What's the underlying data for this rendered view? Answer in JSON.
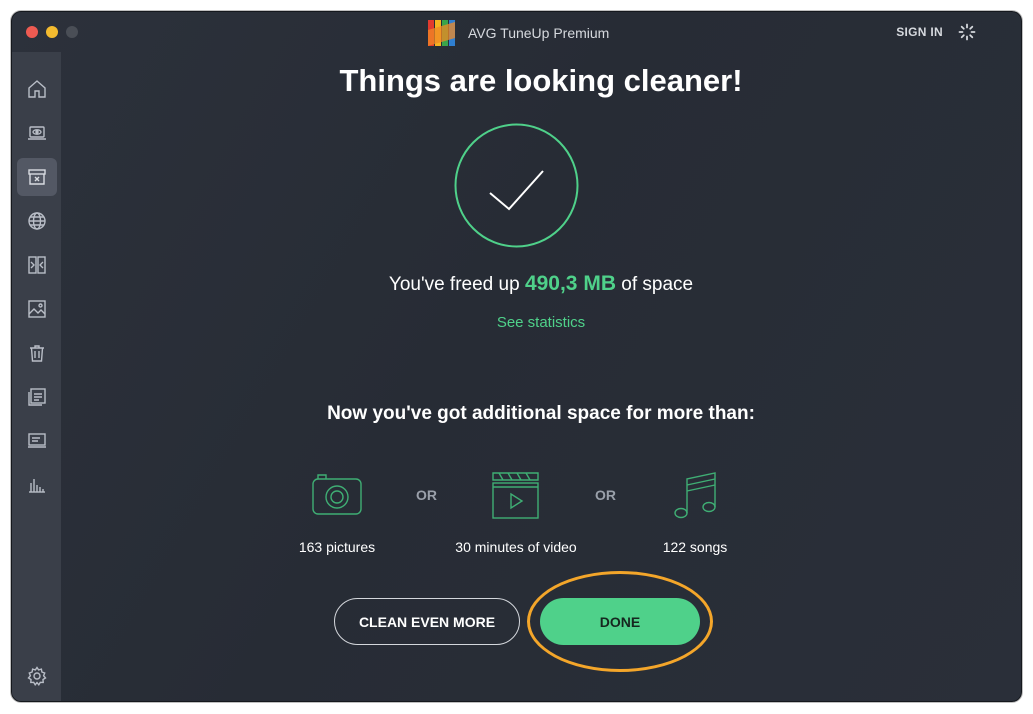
{
  "window": {
    "app_title": "AVG TuneUp Premium",
    "sign_in_label": "SIGN IN"
  },
  "sidebar": {
    "items": [
      {
        "icon": "home-icon",
        "active": false
      },
      {
        "icon": "laptop-eye-icon",
        "active": false
      },
      {
        "icon": "archive-icon",
        "active": true
      },
      {
        "icon": "globe-icon",
        "active": false
      },
      {
        "icon": "duplicate-files-icon",
        "active": false
      },
      {
        "icon": "photo-icon",
        "active": false
      },
      {
        "icon": "trash-icon",
        "active": false
      },
      {
        "icon": "apps-list-icon",
        "active": false
      },
      {
        "icon": "monitor-icon",
        "active": false
      },
      {
        "icon": "bar-chart-icon",
        "active": false
      }
    ],
    "settings_icon": "gear-icon"
  },
  "main": {
    "headline": "Things are looking cleaner!",
    "freed_prefix": "You've freed up",
    "freed_amount": "490,3 MB",
    "freed_suffix": "of space",
    "stats_link": "See statistics",
    "subhead": "Now you've got additional space for more than:",
    "equivalents": [
      {
        "icon": "camera-icon",
        "label": "163 pictures"
      },
      {
        "icon": "video-clapper-icon",
        "label": "30 minutes of video"
      },
      {
        "icon": "music-note-icon",
        "label": "122 songs"
      }
    ],
    "or_label": "OR",
    "clean_button": "CLEAN EVEN MORE",
    "done_button": "DONE"
  },
  "colors": {
    "accent_green": "#4fd18a",
    "highlight_orange": "#f4a62a",
    "sidebar_bg": "#3a3f49",
    "window_bg": "#2a2f39"
  }
}
